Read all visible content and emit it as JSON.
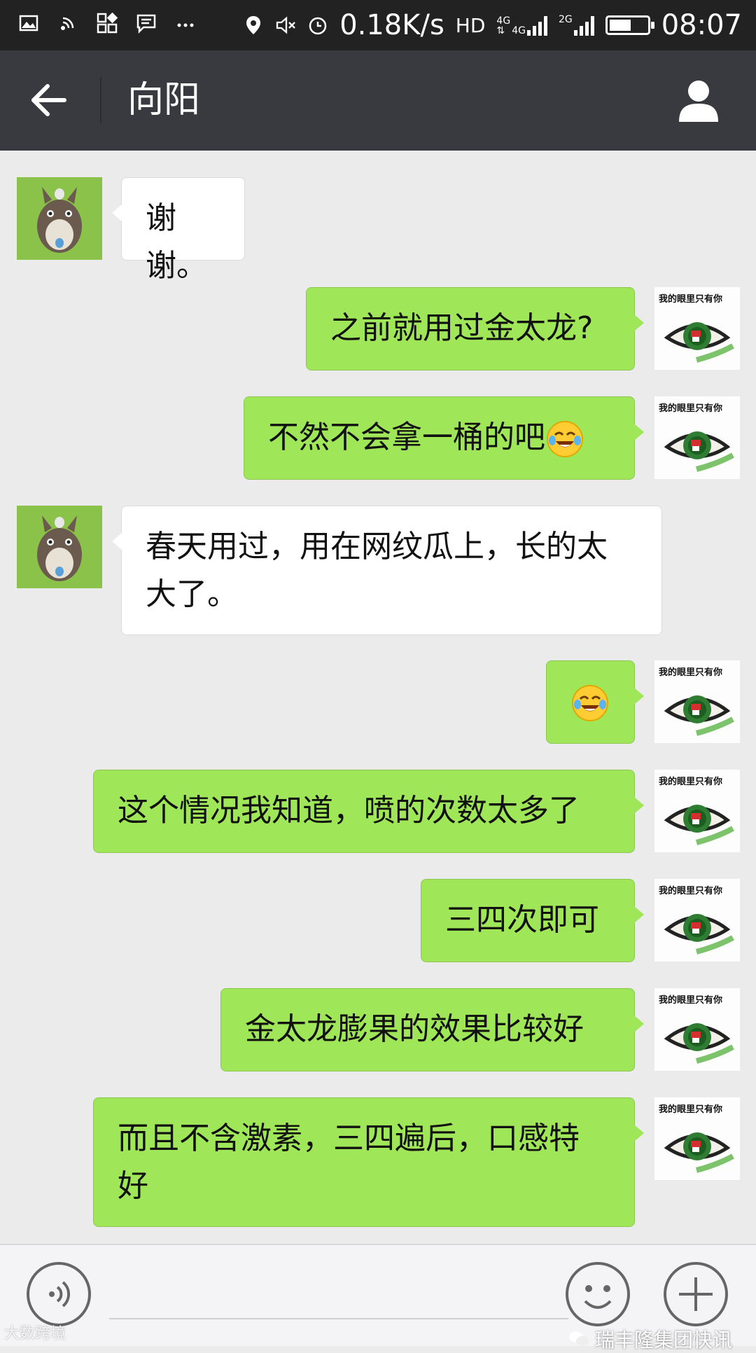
{
  "status_bar": {
    "speed": "0.18K/s",
    "hd": "HD",
    "net_a": "4G",
    "net_b": "4G",
    "net_c": "2G",
    "time": "08:07",
    "icons": [
      "image-icon",
      "wifi-icon",
      "apps-icon",
      "message-icon",
      "more-dots-icon",
      "location-icon",
      "mute-icon",
      "alarm-icon",
      "signal-icon",
      "battery-icon"
    ]
  },
  "header": {
    "title": "向阳",
    "back_icon": "arrow-left-icon",
    "profile_icon": "person-icon"
  },
  "messages": [
    {
      "side": "left",
      "text": "谢谢。"
    },
    {
      "side": "right",
      "text": "之前就用过金太龙?"
    },
    {
      "side": "right",
      "text": "不然不会拿一桶的吧",
      "emoji": "tears-of-joy-emoji"
    },
    {
      "side": "left",
      "text": "春天用过，用在网纹瓜上，长的太\n大了。"
    },
    {
      "side": "right",
      "text": "",
      "emoji": "laughing-tears-emoji"
    },
    {
      "side": "right",
      "text": "这个情况我知道，喷的次数太多了"
    },
    {
      "side": "right",
      "text": "三四次即可"
    },
    {
      "side": "right",
      "text": "金太龙膨果的效果比较好"
    },
    {
      "side": "right",
      "text": "而且不含激素，三四遍后，口感特\n好"
    }
  ],
  "avatars": {
    "contact": "totoro-avatar",
    "self_caption": "我的眼里只有你"
  },
  "input_bar": {
    "voice_icon": "voice-icon",
    "emoji_icon": "emoji-icon",
    "plus_icon": "plus-icon"
  },
  "watermarks": {
    "left": "大数跨境",
    "right": "瑞丰隆集团快讯"
  },
  "colors": {
    "status_bar_bg": "#222222",
    "title_bar_bg": "#393a3f",
    "chat_bg": "#ebebeb",
    "bubble_self": "#9fe658",
    "bubble_other": "#ffffff"
  }
}
